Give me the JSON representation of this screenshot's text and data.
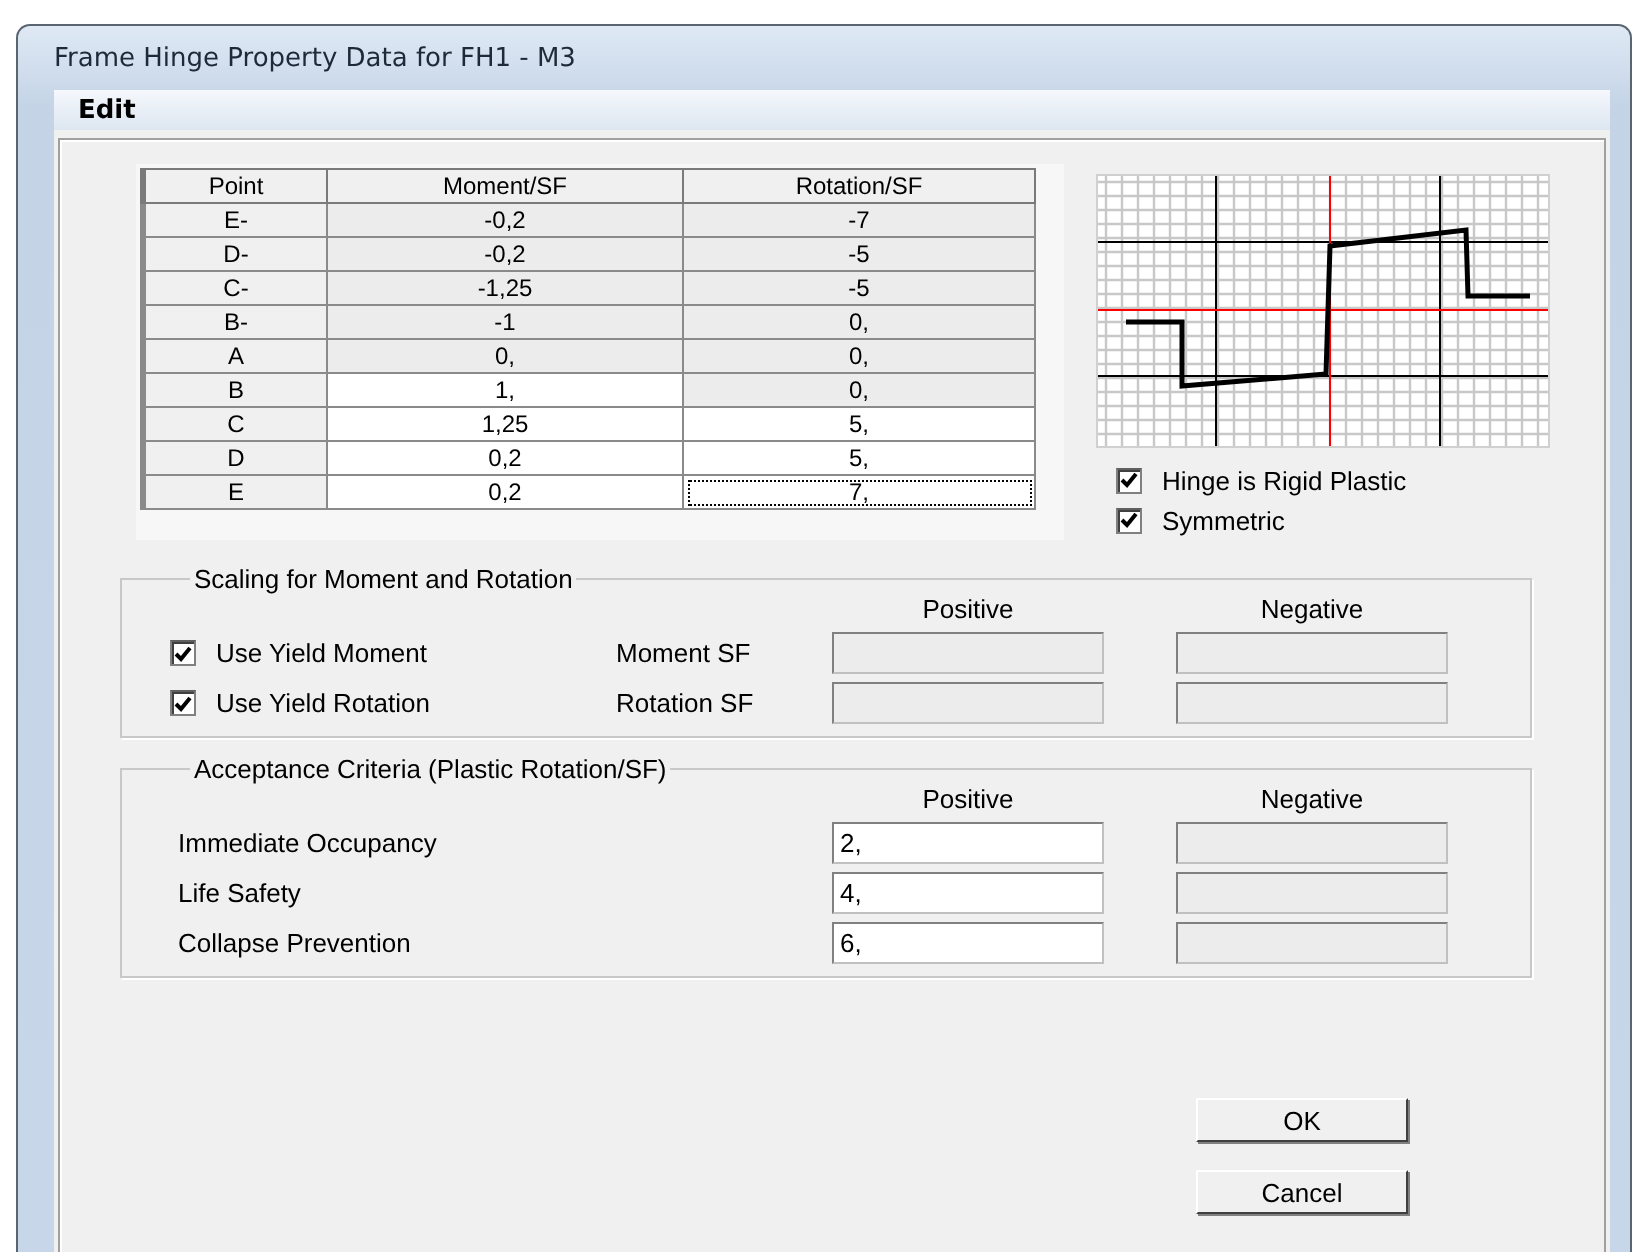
{
  "window": {
    "title": "Frame Hinge Property Data for FH1 - M3"
  },
  "menu": [
    {
      "label": "Edit"
    }
  ],
  "table": {
    "columns": [
      "Point",
      "Moment/SF",
      "Rotation/SF"
    ],
    "rows": [
      {
        "cells": [
          {
            "text": "E-",
            "kind": "point",
            "disabled": true,
            "focused": false
          },
          {
            "text": "-0,2",
            "disabled": true,
            "focused": false
          },
          {
            "text": "-7",
            "disabled": true,
            "focused": false
          }
        ]
      },
      {
        "cells": [
          {
            "text": "D-",
            "kind": "point",
            "disabled": true,
            "focused": false
          },
          {
            "text": "-0,2",
            "disabled": true,
            "focused": false
          },
          {
            "text": "-5",
            "disabled": true,
            "focused": false
          }
        ]
      },
      {
        "cells": [
          {
            "text": "C-",
            "kind": "point",
            "disabled": true,
            "focused": false
          },
          {
            "text": "-1,25",
            "disabled": true,
            "focused": false
          },
          {
            "text": "-5",
            "disabled": true,
            "focused": false
          }
        ]
      },
      {
        "cells": [
          {
            "text": "B-",
            "kind": "point",
            "disabled": true,
            "focused": false
          },
          {
            "text": "-1",
            "disabled": true,
            "focused": false
          },
          {
            "text": "0,",
            "disabled": true,
            "focused": false
          }
        ]
      },
      {
        "cells": [
          {
            "text": "A",
            "kind": "point",
            "disabled": true,
            "focused": false
          },
          {
            "text": "0,",
            "disabled": true,
            "focused": false
          },
          {
            "text": "0,",
            "disabled": true,
            "focused": false
          }
        ]
      },
      {
        "cells": [
          {
            "text": "B",
            "kind": "point",
            "disabled": true,
            "focused": false
          },
          {
            "text": "1,",
            "disabled": false,
            "focused": false
          },
          {
            "text": "0,",
            "disabled": true,
            "focused": false
          }
        ]
      },
      {
        "cells": [
          {
            "text": "C",
            "kind": "point",
            "disabled": true,
            "focused": false
          },
          {
            "text": "1,25",
            "disabled": false,
            "focused": false
          },
          {
            "text": "5,",
            "disabled": false,
            "focused": false
          }
        ]
      },
      {
        "cells": [
          {
            "text": "D",
            "kind": "point",
            "disabled": true,
            "focused": false
          },
          {
            "text": "0,2",
            "disabled": false,
            "focused": false
          },
          {
            "text": "5,",
            "disabled": false,
            "focused": false
          }
        ]
      },
      {
        "cells": [
          {
            "text": "E",
            "kind": "point",
            "disabled": true,
            "focused": false
          },
          {
            "text": "0,2",
            "disabled": false,
            "focused": false
          },
          {
            "text": "7,",
            "disabled": false,
            "focused": true
          }
        ]
      }
    ]
  },
  "options": [
    {
      "label": "Hinge is Rigid Plastic",
      "checked": true
    },
    {
      "label": "Symmetric",
      "checked": true
    }
  ],
  "scaling": {
    "title": "Scaling for Moment and Rotation",
    "column_headers": [
      "Positive",
      "Negative"
    ],
    "rows": [
      {
        "checkbox": {
          "label": "Use Yield Moment",
          "checked": true
        },
        "label": "Moment SF",
        "positive": {
          "disabled": true
        },
        "negative": {
          "disabled": true
        }
      },
      {
        "checkbox": {
          "label": "Use Yield Rotation",
          "checked": true
        },
        "label": "Rotation SF",
        "positive": {
          "disabled": true
        },
        "negative": {
          "disabled": true
        }
      }
    ]
  },
  "acceptance": {
    "title": "Acceptance Criteria (Plastic Rotation/SF)",
    "column_headers": [
      "Positive",
      "Negative"
    ],
    "rows": [
      {
        "label": "Immediate Occupancy",
        "positive": {
          "value": "2,",
          "disabled": false
        },
        "negative": {
          "disabled": true
        }
      },
      {
        "label": "Life Safety",
        "positive": {
          "value": "4,",
          "disabled": false
        },
        "negative": {
          "disabled": true
        }
      },
      {
        "label": "Collapse Prevention",
        "positive": {
          "value": "6,",
          "disabled": false
        },
        "negative": {
          "disabled": true
        }
      }
    ]
  },
  "buttons": [
    "OK",
    "Cancel"
  ]
}
